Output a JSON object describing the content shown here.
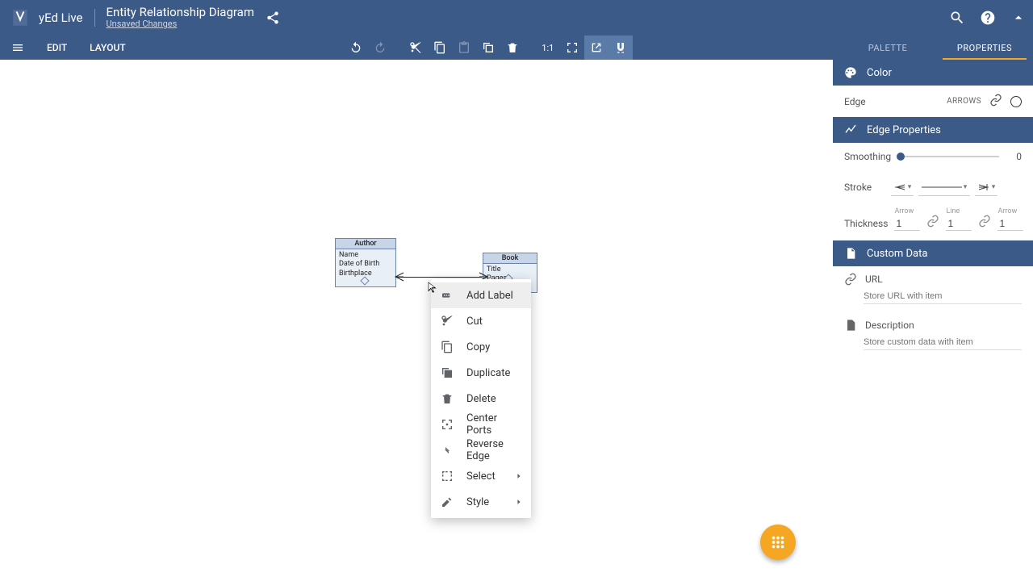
{
  "header": {
    "app_name": "yEd Live",
    "doc_title": "Entity Relationship Diagram",
    "unsaved": "Unsaved Changes"
  },
  "menus": {
    "edit": "EDIT",
    "layout": "LAYOUT"
  },
  "right_tabs": {
    "palette": "PALETTE",
    "properties": "PROPERTIES"
  },
  "diagram": {
    "entities": {
      "author": {
        "title": "Author",
        "attrs": [
          "Name",
          "Date of Birth",
          "Birthplace"
        ]
      },
      "book": {
        "title": "Book",
        "attrs": [
          "Title",
          "Pages"
        ]
      }
    }
  },
  "context_menu": {
    "add_label": "Add Label",
    "cut": "Cut",
    "copy": "Copy",
    "duplicate": "Duplicate",
    "delete": "Delete",
    "center_ports": "Center Ports",
    "reverse_edge": "Reverse Edge",
    "select": "Select",
    "style": "Style"
  },
  "panel": {
    "color": {
      "title": "Color",
      "edge_label": "Edge",
      "arrows_label": "ARROWS"
    },
    "edge_props": {
      "title": "Edge Properties",
      "smoothing": "Smoothing",
      "smoothing_val": "0",
      "stroke": "Stroke",
      "thickness": "Thickness",
      "arrow": "Arrow",
      "line": "Line",
      "val1": "1",
      "val2": "1",
      "val3": "1"
    },
    "custom_data": {
      "title": "Custom Data",
      "url_label": "URL",
      "url_placeholder": "Store URL with item",
      "desc_label": "Description",
      "desc_placeholder": "Store custom data with item"
    }
  },
  "toolbar": {
    "zoom_label": "1:1"
  }
}
